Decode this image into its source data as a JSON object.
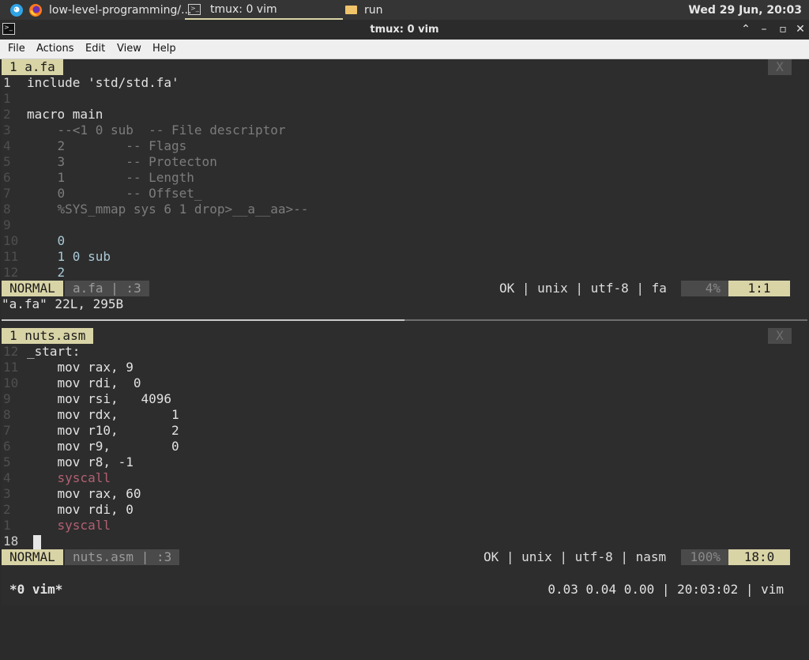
{
  "taskbar": {
    "firefox_title": "low-level-programming/...",
    "terminal_title": "tmux: 0 vim",
    "folder_title": "run",
    "clock": "Wed 29 Jun, 20:03"
  },
  "window": {
    "title": "tmux: 0 vim"
  },
  "menu": {
    "file": "File",
    "actions": "Actions",
    "edit": "Edit",
    "view": "View",
    "help": "Help"
  },
  "top_pane": {
    "tab_label": "1 a.fa",
    "close_label": "X",
    "lines": [
      {
        "n": "1",
        "text": "include 'std/std.fa'"
      },
      {
        "n": "1",
        "text": ""
      },
      {
        "n": "2",
        "text": "macro main"
      },
      {
        "n": "3",
        "text": "    --<1 0 sub  -- File descriptor"
      },
      {
        "n": "4",
        "text": "    2        -- Flags"
      },
      {
        "n": "5",
        "text": "    3        -- Protecton"
      },
      {
        "n": "6",
        "text": "    1        -- Length"
      },
      {
        "n": "7",
        "text": "    0        -- Offset_"
      },
      {
        "n": "8",
        "text": "    %SYS_mmap sys 6 1 drop>__a__aa>--"
      },
      {
        "n": "9",
        "text": ""
      },
      {
        "n": "10",
        "text": "    0"
      },
      {
        "n": "11",
        "text": "    1 0 sub"
      },
      {
        "n": "12",
        "text": "    2"
      }
    ],
    "status": {
      "mode": "NORMAL",
      "file": "a.fa | :3",
      "info": "OK | unix | utf-8 | fa",
      "percent": "4%",
      "position": "1:1"
    },
    "message": "\"a.fa\" 22L, 295B"
  },
  "bottom_pane": {
    "tab_label": "1 nuts.asm",
    "close_label": "X",
    "lines": [
      {
        "n": "12",
        "text": "_start:"
      },
      {
        "n": "11",
        "text": "    mov rax, 9"
      },
      {
        "n": "10",
        "text": "    mov rdi,  0"
      },
      {
        "n": "9",
        "text": "    mov rsi,   4096"
      },
      {
        "n": "8",
        "text": "    mov rdx,       1"
      },
      {
        "n": "7",
        "text": "    mov r10,       2"
      },
      {
        "n": "6",
        "text": "    mov r9,        0"
      },
      {
        "n": "5",
        "text": "    mov r8, -1"
      },
      {
        "n": "4",
        "text": "    syscall"
      },
      {
        "n": "3",
        "text": "    mov rax, 60"
      },
      {
        "n": "2",
        "text": "    mov rdi, 0"
      },
      {
        "n": "1",
        "text": "    syscall"
      },
      {
        "n": "18",
        "text": ""
      }
    ],
    "status": {
      "mode": "NORMAL",
      "file": "nuts.asm | :3",
      "info": "OK | unix | utf-8 | nasm",
      "percent": "100%",
      "position": "18:0"
    }
  },
  "tmux": {
    "left": "*0 vim*",
    "right": "0.03 0.04 0.00 | 20:03:02 | vim"
  }
}
